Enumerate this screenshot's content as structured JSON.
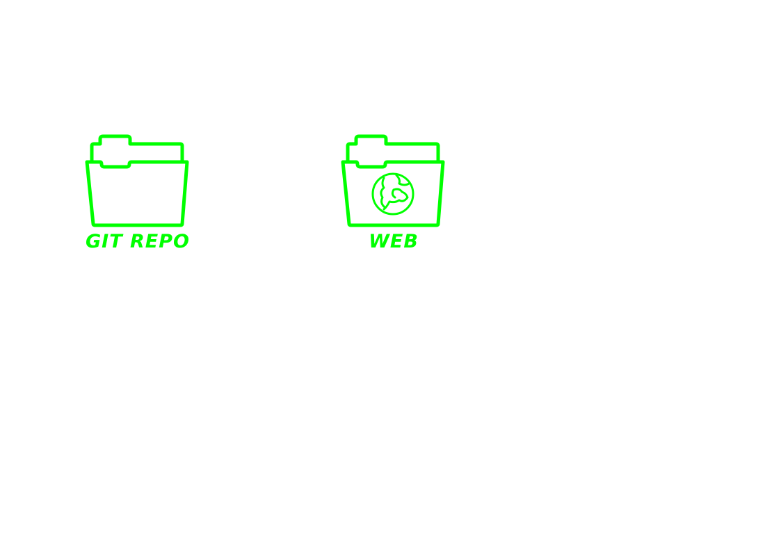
{
  "desktop": {
    "accent_color": "#00ff00",
    "icons": [
      {
        "label": "Git repo",
        "icon": "folder-icon"
      },
      {
        "label": "Web",
        "icon": "folder-globe-icon"
      }
    ]
  }
}
